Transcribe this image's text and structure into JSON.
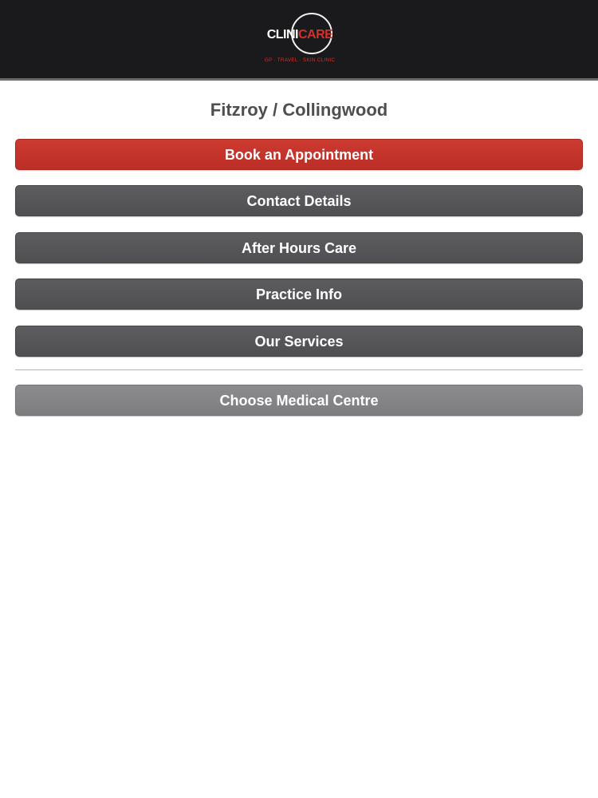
{
  "header": {
    "logo": {
      "part1": "CLINI",
      "part2": "CARE",
      "tagline": "GP · TRAVEL · SKIN CLINIC"
    }
  },
  "page_title": "Fitzroy / Collingwood",
  "menu": {
    "book": "Book an Appointment",
    "contact": "Contact Details",
    "after_hours": "After Hours Care",
    "practice_info": "Practice Info",
    "services": "Our Services",
    "choose_centre": "Choose Medical Centre"
  },
  "colors": {
    "header_bg": "#1a191b",
    "accent_red": "#c0322a",
    "button_dark": "#555457",
    "button_light": "#858487",
    "title_text": "#4e4d50"
  }
}
